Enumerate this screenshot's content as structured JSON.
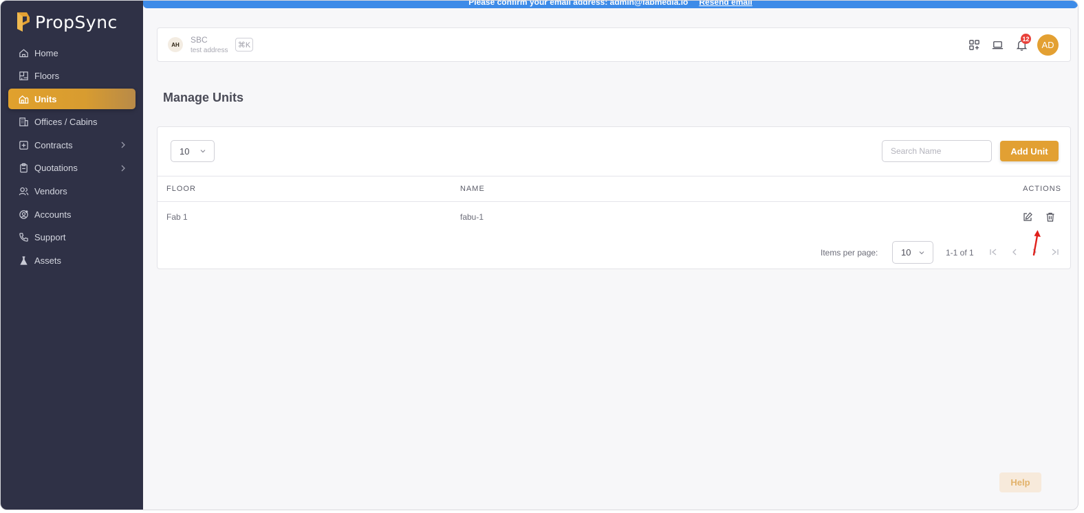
{
  "app": {
    "name": "PropSync"
  },
  "banner": {
    "message": "Please confirm your email address: admin@fabmedia.io",
    "link": "Resend email"
  },
  "sidebar": {
    "items": [
      {
        "label": "Home",
        "icon": "home-icon",
        "active": false
      },
      {
        "label": "Floors",
        "icon": "floor-plan-icon",
        "active": false
      },
      {
        "label": "Units",
        "icon": "building-icon",
        "active": true
      },
      {
        "label": "Offices / Cabins",
        "icon": "office-icon",
        "active": false
      },
      {
        "label": "Contracts",
        "icon": "contract-icon",
        "active": false,
        "expandable": true
      },
      {
        "label": "Quotations",
        "icon": "clipboard-icon",
        "active": false,
        "expandable": true
      },
      {
        "label": "Vendors",
        "icon": "users-icon",
        "active": false
      },
      {
        "label": "Accounts",
        "icon": "account-icon",
        "active": false
      },
      {
        "label": "Support",
        "icon": "phone-icon",
        "active": false
      },
      {
        "label": "Assets",
        "icon": "flask-icon",
        "active": false
      }
    ]
  },
  "header": {
    "org_logo_text": "AH",
    "org_name": "SBC",
    "org_address": "test address",
    "shortcut": "⌘K",
    "notification_count": "12",
    "avatar_initials": "AD"
  },
  "page": {
    "title": "Manage Units"
  },
  "toolbar": {
    "page_size": "10",
    "search_placeholder": "Search Name",
    "add_label": "Add Unit"
  },
  "table": {
    "columns": [
      "FLOOR",
      "NAME",
      "ACTIONS"
    ],
    "rows": [
      {
        "floor": "Fab 1",
        "name": "fabu-1"
      }
    ]
  },
  "pagination": {
    "label": "Items per page:",
    "page_size": "10",
    "range": "1-1 of 1"
  },
  "help": {
    "label": "Help"
  },
  "colors": {
    "sidebar_bg": "#2f3146",
    "accent": "#e2a033",
    "banner": "#3d8be8",
    "badge": "#e8413a"
  }
}
